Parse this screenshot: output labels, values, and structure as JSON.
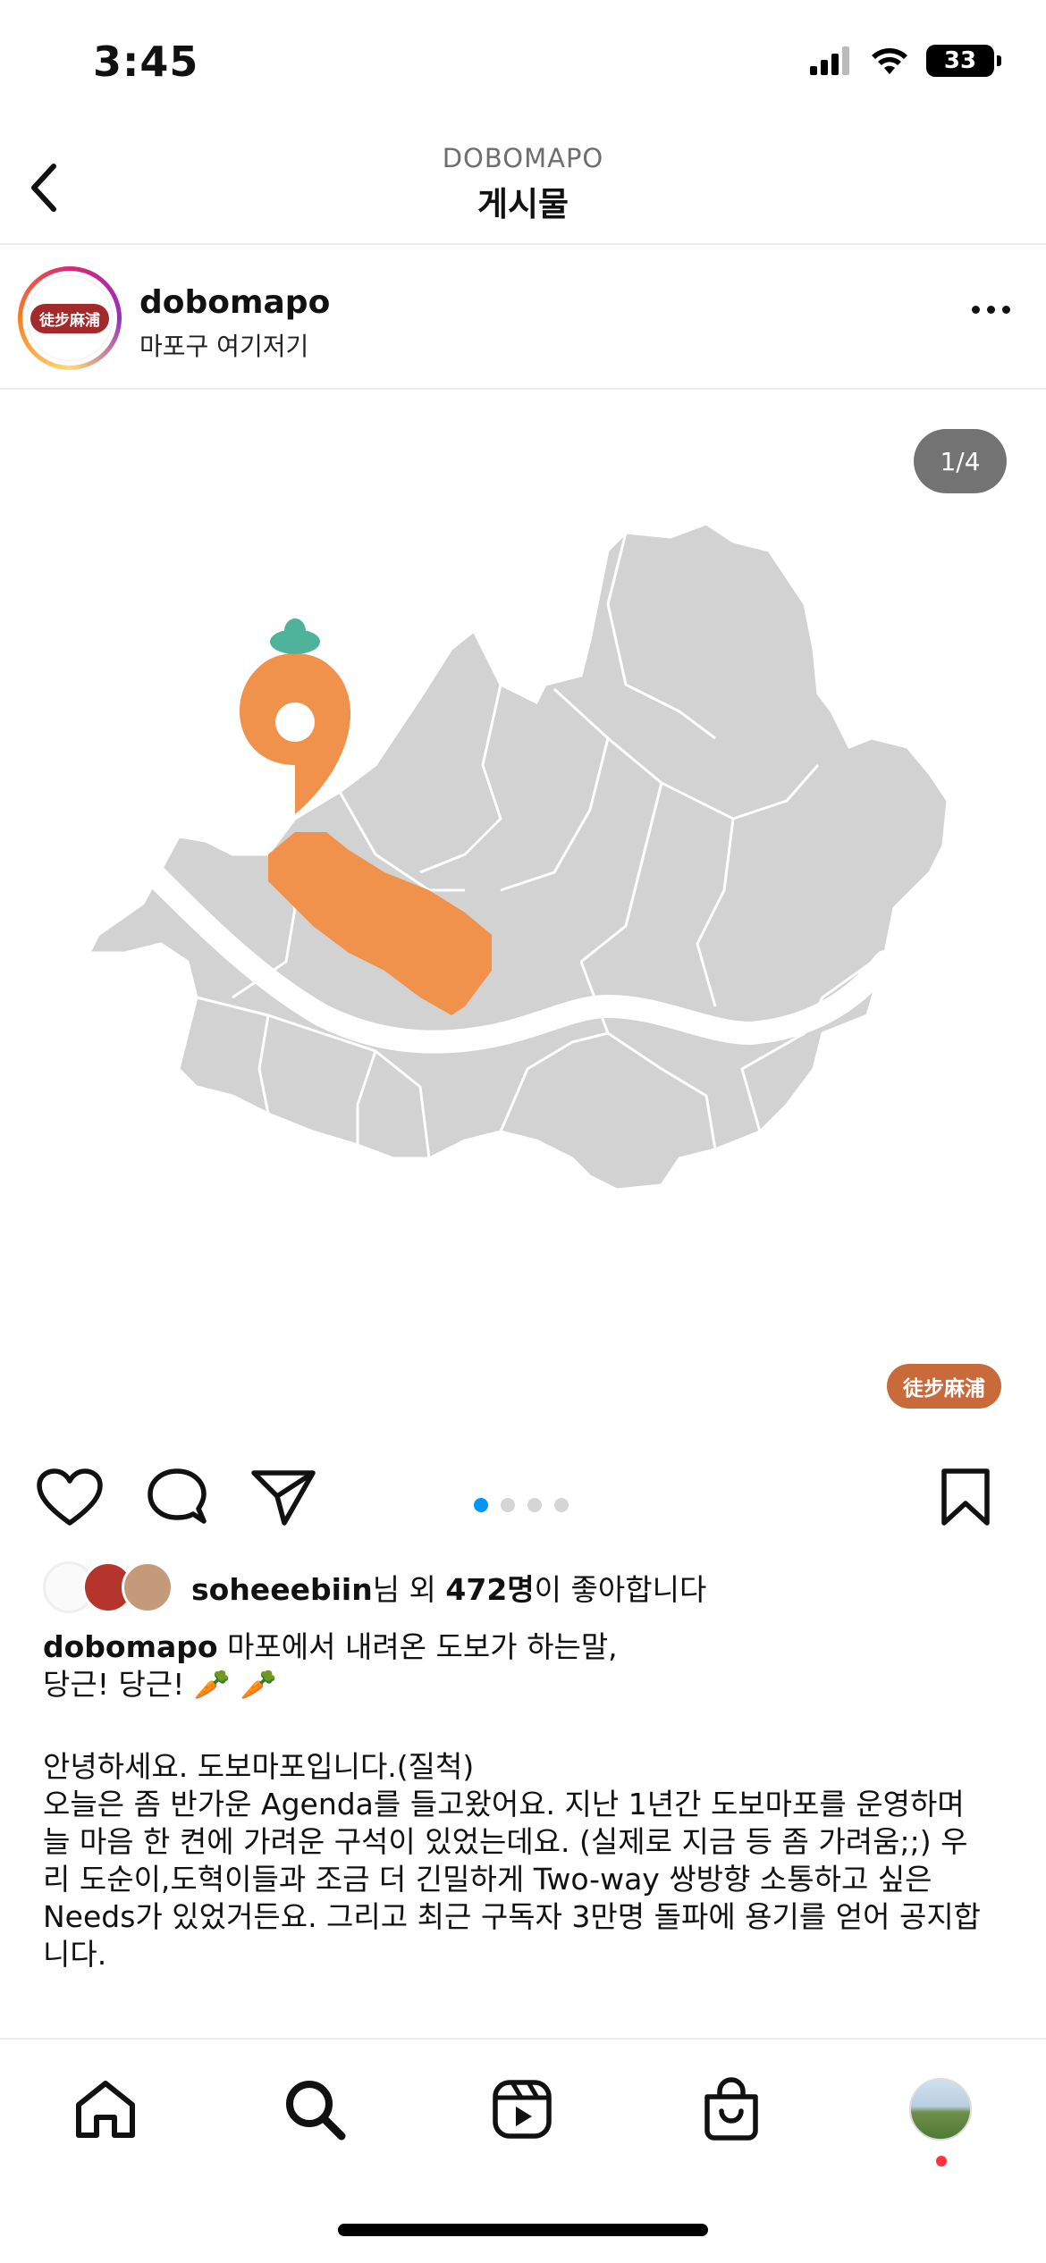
{
  "status_bar": {
    "time": "3:45",
    "battery": "33",
    "icons": [
      "cellular-signal-icon",
      "wifi-icon",
      "battery-icon"
    ]
  },
  "header": {
    "subtitle": "DOBOMAPO",
    "title": "게시물",
    "back_icon": "chevron-left-icon"
  },
  "post": {
    "username": "dobomapo",
    "location": "마포구 여기저기",
    "avatar_logo_text": "徒步麻浦",
    "image_counter": "1/4",
    "watermark": "徒步麻浦",
    "colors": {
      "highlight_district": "#f0914c",
      "map_gray": "#d0d0d0",
      "river": "#ffffff",
      "carrot_leaf": "#4fb39b"
    }
  },
  "actions": {
    "like_icon": "heart-icon",
    "comment_icon": "comment-icon",
    "share_icon": "send-icon",
    "save_icon": "bookmark-icon",
    "carousel_total": 4,
    "carousel_active": 1
  },
  "likes": {
    "user": "soheeebiin",
    "mid": "님 외 ",
    "count": "472명",
    "suffix": "이 좋아합니다"
  },
  "caption": {
    "username": "dobomapo",
    "line1": " 마포에서 내려온 도보가 하는말,",
    "line2": "당근! 당근! 🥕 🥕",
    "para1": "안녕하세요. 도보마포입니다.(질척)",
    "para2_l1": "오늘은 좀 반가운 Agenda를 들고왔어요. 지난 1년간 도보마포를 운영하며",
    "para2_l2": "늘 마음 한 켠에 가려운 구석이 있었는데요. (실제로 지금 등 좀 가려움;;) 우",
    "para2_l3": "리 도순이,도혁이들과 조금 더 긴밀하게 Two-way 쌍방향 소통하고 싶은",
    "para2_l4": "Needs가 있었거든요. 그리고 최근 구독자 3만명 돌파에 용기를 얻어 공지합",
    "para2_l5": "니다."
  },
  "bottom_nav": {
    "items": [
      "home-icon",
      "search-icon",
      "reels-icon",
      "shop-icon",
      "profile-avatar"
    ]
  }
}
